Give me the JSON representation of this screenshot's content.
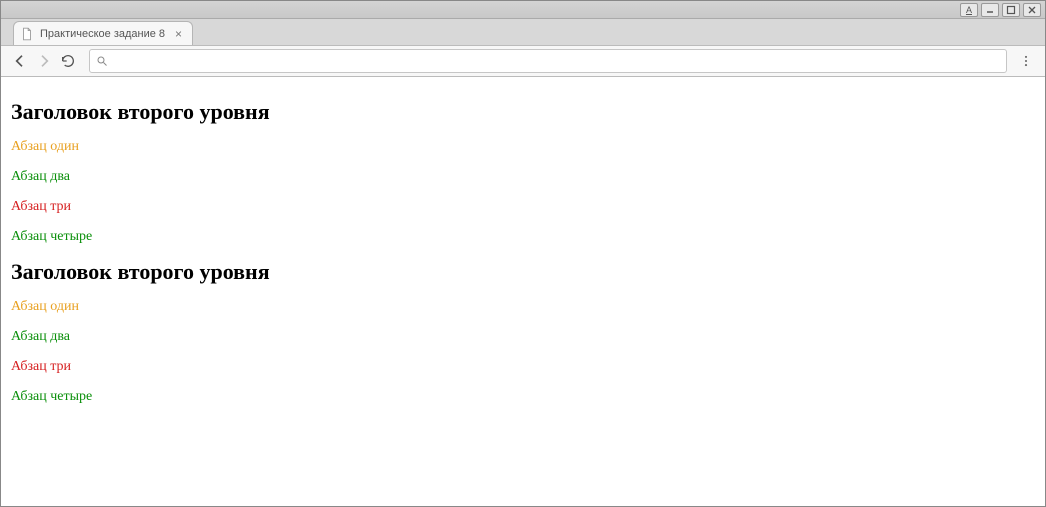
{
  "window": {
    "tab_title": "Практическое задание 8",
    "address_value": ""
  },
  "sections": [
    {
      "heading": "Заголовок второго уровня",
      "paragraphs": [
        {
          "text": "Абзац один",
          "color": "orange"
        },
        {
          "text": "Абзац два",
          "color": "green"
        },
        {
          "text": "Абзац три",
          "color": "red"
        },
        {
          "text": "Абзац четыре",
          "color": "green"
        }
      ]
    },
    {
      "heading": "Заголовок второго уровня",
      "paragraphs": [
        {
          "text": "Абзац один",
          "color": "orange"
        },
        {
          "text": "Абзац два",
          "color": "green"
        },
        {
          "text": "Абзац три",
          "color": "red"
        },
        {
          "text": "Абзац четыре",
          "color": "green"
        }
      ]
    }
  ]
}
